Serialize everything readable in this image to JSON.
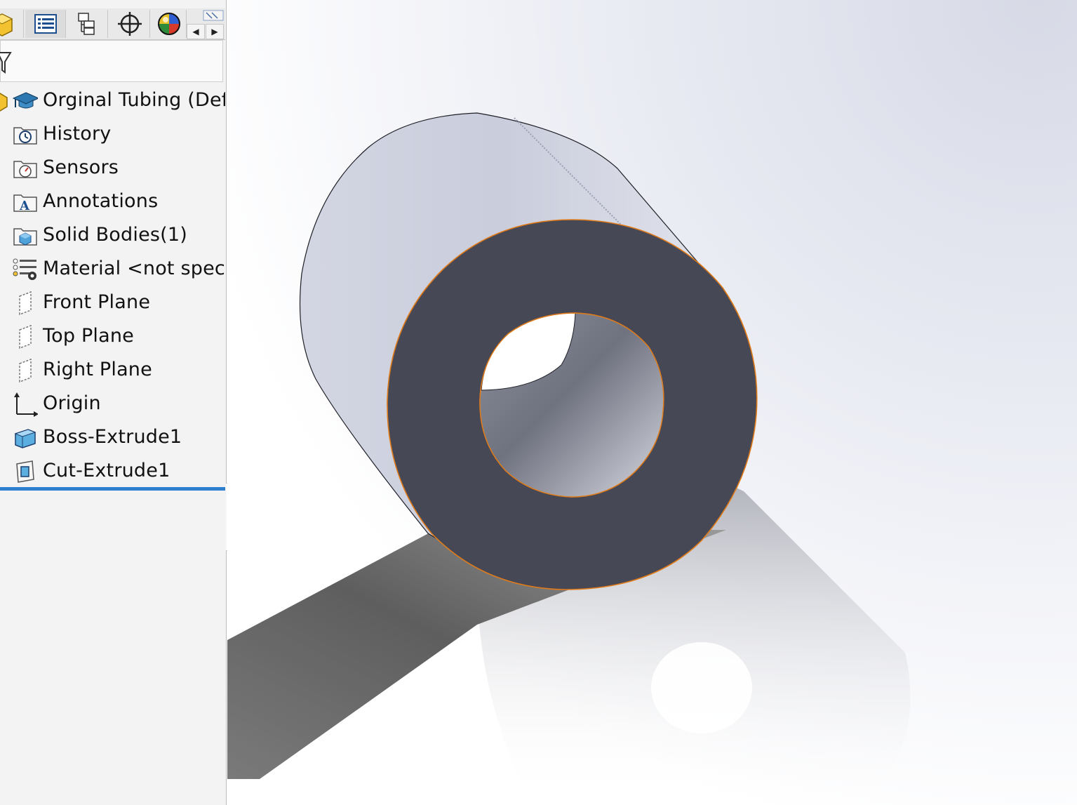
{
  "toolbar": {
    "tabs": [
      {
        "name": "feature-manager-tab",
        "icon": "part-icon"
      },
      {
        "name": "property-manager-tab",
        "icon": "property-list-icon"
      },
      {
        "name": "configuration-manager-tab",
        "icon": "configuration-icon"
      },
      {
        "name": "dimxpert-manager-tab",
        "icon": "crosshair-icon"
      },
      {
        "name": "display-manager-tab",
        "icon": "color-sphere-icon"
      }
    ],
    "scroll_left": "◀",
    "scroll_right": "▶"
  },
  "tree": {
    "root": {
      "label": "Orginal Tubing (Def",
      "icon": "part-icon"
    },
    "items": [
      {
        "label": "History",
        "icon": "history-icon"
      },
      {
        "label": "Sensors",
        "icon": "sensors-icon"
      },
      {
        "label": "Annotations",
        "icon": "annotations-icon"
      },
      {
        "label": "Solid Bodies(1)",
        "icon": "solid-bodies-icon"
      },
      {
        "label": "Material <not speci",
        "icon": "material-icon"
      },
      {
        "label": "Front Plane",
        "icon": "plane-icon"
      },
      {
        "label": "Top Plane",
        "icon": "plane-icon"
      },
      {
        "label": "Right Plane",
        "icon": "plane-icon"
      },
      {
        "label": "Origin",
        "icon": "origin-icon"
      },
      {
        "label": "Boss-Extrude1",
        "icon": "boss-extrude-icon"
      },
      {
        "label": "Cut-Extrude1",
        "icon": "cut-extrude-icon"
      }
    ]
  },
  "colors": {
    "accent": "#2f7fd0",
    "face": "#474855",
    "edge_highlight": "#e07b1a",
    "tube_body": "#c8ccdb"
  }
}
